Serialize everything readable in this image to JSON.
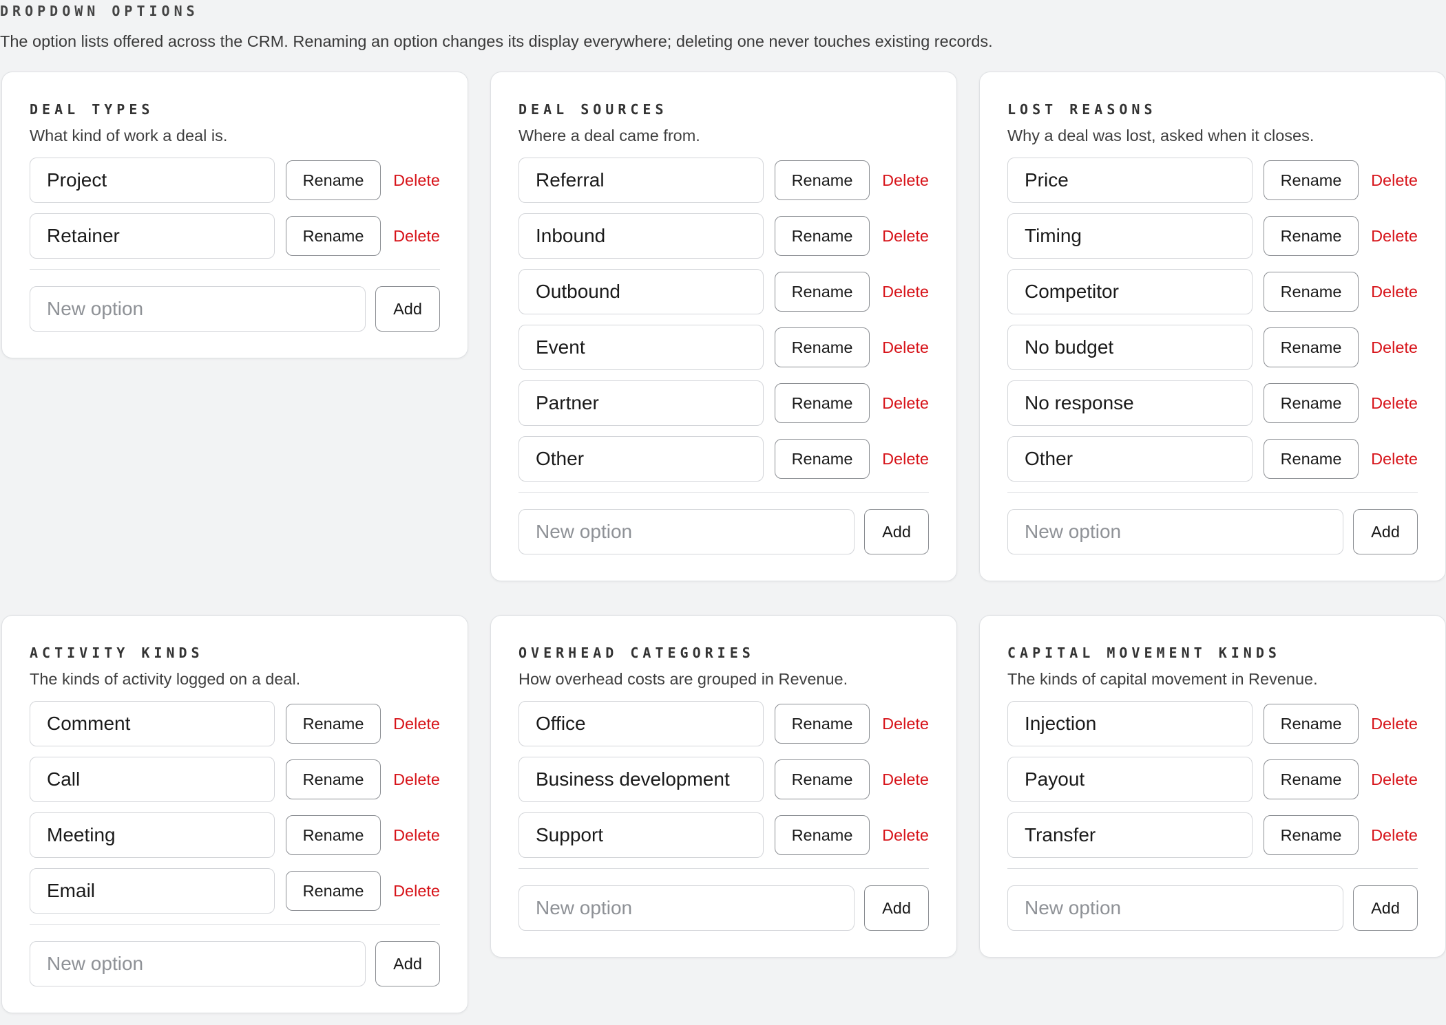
{
  "header": {
    "title": "DROPDOWN OPTIONS",
    "description": "The option lists offered across the CRM. Renaming an option changes its display everywhere; deleting one never touches existing records."
  },
  "common": {
    "rename_label": "Rename",
    "delete_label": "Delete",
    "add_label": "Add",
    "new_option_placeholder": "New option",
    "delete_color": "#d7141a"
  },
  "cards": [
    {
      "title": "DEAL TYPES",
      "description": "What kind of work a deal is.",
      "options": [
        "Project",
        "Retainer"
      ]
    },
    {
      "title": "DEAL SOURCES",
      "description": "Where a deal came from.",
      "options": [
        "Referral",
        "Inbound",
        "Outbound",
        "Event",
        "Partner",
        "Other"
      ]
    },
    {
      "title": "LOST REASONS",
      "description": "Why a deal was lost, asked when it closes.",
      "options": [
        "Price",
        "Timing",
        "Competitor",
        "No budget",
        "No response",
        "Other"
      ]
    },
    {
      "title": "ACTIVITY KINDS",
      "description": "The kinds of activity logged on a deal.",
      "options": [
        "Comment",
        "Call",
        "Meeting",
        "Email"
      ]
    },
    {
      "title": "OVERHEAD CATEGORIES",
      "description": "How overhead costs are grouped in Revenue.",
      "options": [
        "Office",
        "Business development",
        "Support"
      ]
    },
    {
      "title": "CAPITAL MOVEMENT KINDS",
      "description": "The kinds of capital movement in Revenue.",
      "options": [
        "Injection",
        "Payout",
        "Transfer"
      ]
    }
  ]
}
